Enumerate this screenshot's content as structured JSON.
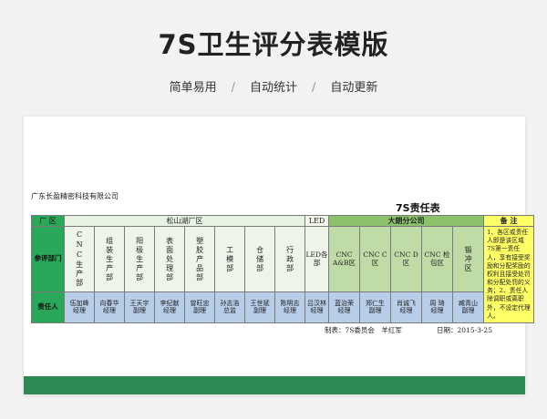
{
  "page": {
    "title": "7S卫生评分表模版",
    "features": [
      "简单易用",
      "自动统计",
      "自动更新"
    ]
  },
  "sheet": {
    "company": "广东长盈精密科技有限公司",
    "title": "7S责任表",
    "header": {
      "area_label": "厂 区",
      "songshan": "松山湖厂区",
      "led": "LED",
      "dalang": "大朗分公司",
      "remark": "备 注"
    },
    "row_labels": {
      "dept": "参评部门",
      "person": "责任人"
    },
    "departments": [
      "CNC生产部",
      "组装生产部",
      "阳极生产部",
      "表面处理部",
      "塑胶产品部",
      "工模部",
      "仓储部",
      "行政部",
      "LED各部",
      "CNC A&B区",
      "CNC C区",
      "CNC D区",
      "CNC 检包区",
      "锻冲区"
    ],
    "persons": [
      [
        "伍加峰",
        "经理"
      ],
      [
        "向春华",
        "经理"
      ],
      [
        "王天宇",
        "副理"
      ],
      [
        "李纪献",
        "经理"
      ],
      [
        "曾旺忠",
        "副理"
      ],
      [
        "孙志浩",
        "总监"
      ],
      [
        "王世斌",
        "副理"
      ],
      [
        "陈明志",
        "经理"
      ],
      [
        "吕汉林",
        "经理"
      ],
      [
        "蓝治荣",
        "经理"
      ],
      [
        "郑仁生",
        "副理"
      ],
      [
        "肖诚飞",
        "经理"
      ],
      [
        "周 琦",
        "经理"
      ],
      [
        "臧青山",
        "副理"
      ]
    ],
    "note": "1、各区或责任人即是该区域7S第一责任人，享有接受奖励和分配奖励的权利且接受处罚和分配处罚的义务；2、责任人除调职或离职外，不设定代理人。",
    "footer": {
      "made_by": "制表：7S委员会　羊红军",
      "date": "日期：2015-3-25"
    }
  },
  "colors": {
    "green_band": "#2d8a57",
    "header_green": "#29a85a",
    "header_mid": "#8cc26a",
    "highlight_yellow": "#ffff66",
    "person_blue": "#b7cde8"
  }
}
